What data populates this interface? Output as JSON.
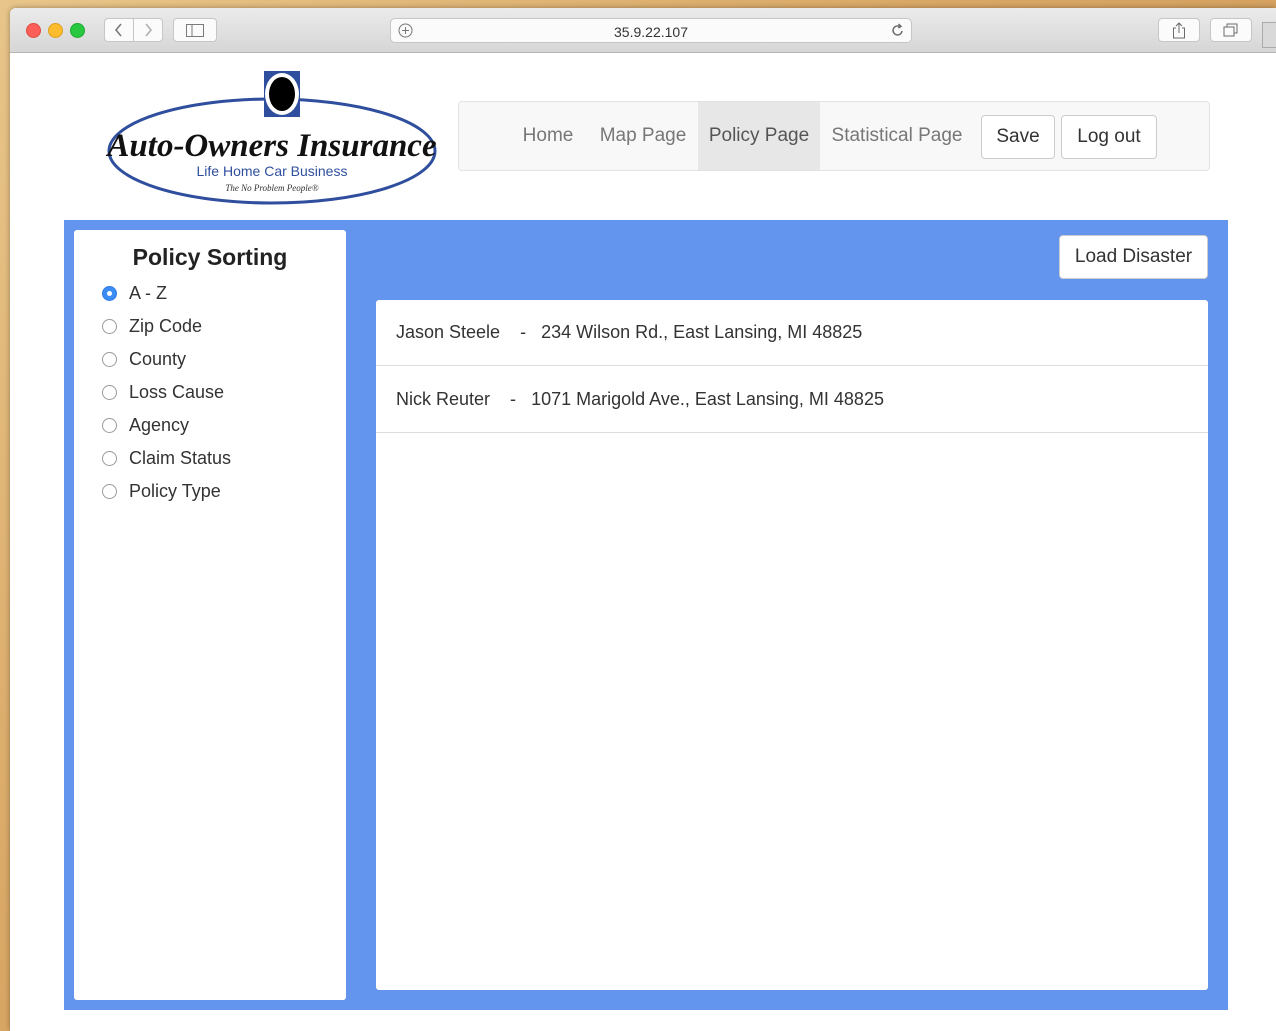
{
  "browser": {
    "address": "35.9.22.107"
  },
  "logo": {
    "name": "Auto-Owners Insurance",
    "tagline": "Life Home Car Business",
    "slogan": "The No Problem People®"
  },
  "nav": {
    "home": "Home",
    "map": "Map Page",
    "policy": "Policy Page",
    "statistical": "Statistical Page",
    "save": "Save",
    "logout": "Log out"
  },
  "sorting": {
    "title": "Policy Sorting",
    "selected": "A - Z",
    "options": [
      "A - Z",
      "Zip Code",
      "County",
      "Loss Cause",
      "Agency",
      "Claim Status",
      "Policy Type"
    ]
  },
  "main": {
    "load_button": "Load Disaster",
    "policies": [
      {
        "name": "Jason Steele",
        "separator": "-",
        "address": "234 Wilson Rd., East Lansing, MI 48825"
      },
      {
        "name": "Nick Reuter",
        "separator": "-",
        "address": "1071 Marigold Ave., East Lansing, MI 48825"
      }
    ]
  },
  "colors": {
    "panel_blue": "#6394ee",
    "radio_selected": "#3b8df5"
  }
}
